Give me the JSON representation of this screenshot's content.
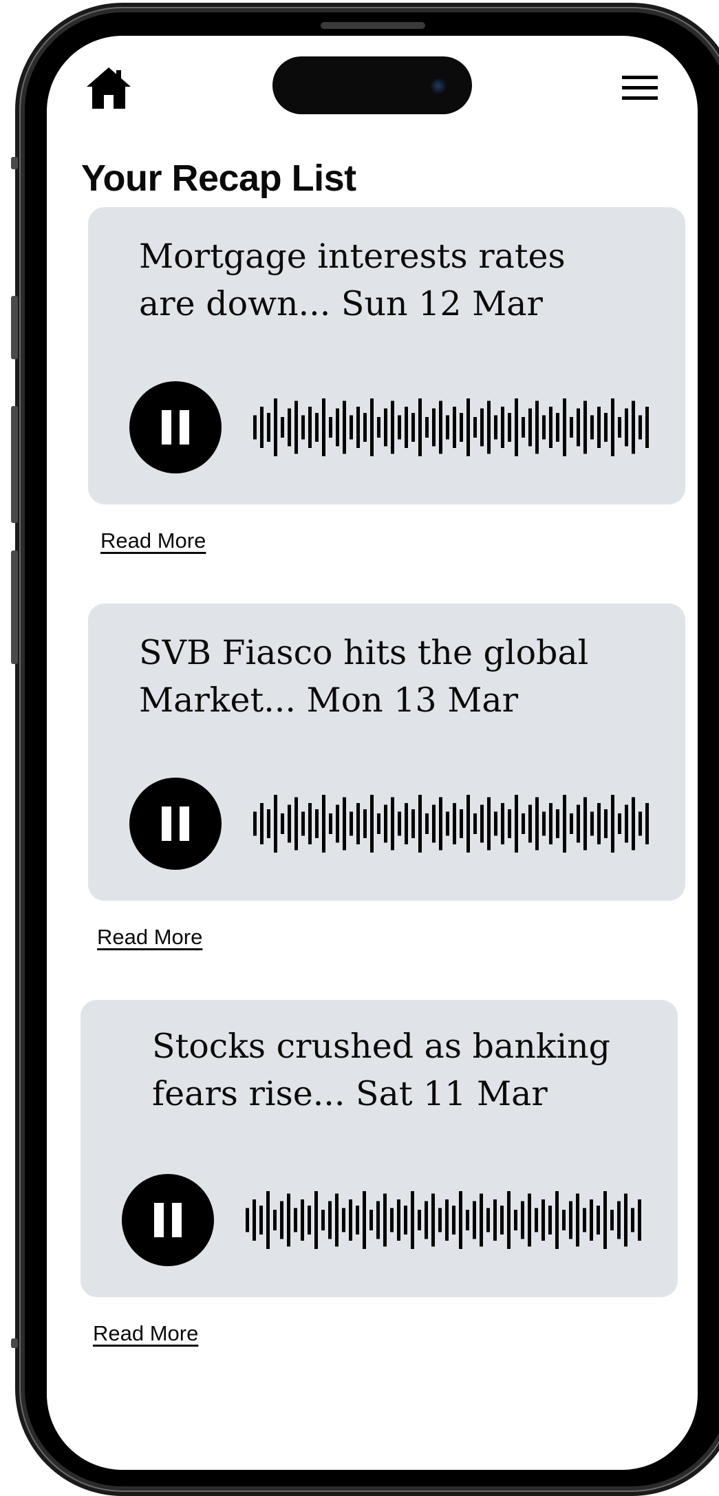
{
  "app": {
    "home_icon": "home-icon",
    "menu_icon": "hamburger-menu-icon"
  },
  "page": {
    "title": "Your Recap List"
  },
  "recaps": [
    {
      "text": "Mortgage interests rates are down... Sun 12 Mar",
      "control_icon": "pause-icon",
      "read_more": "Read More"
    },
    {
      "text": "SVB Fiasco hits the global Market... Mon 13 Mar",
      "control_icon": "pause-icon",
      "read_more": "Read More"
    },
    {
      "text": "Stocks crushed as banking fears rise... Sat 11 Mar",
      "control_icon": "pause-icon",
      "read_more": "Read More"
    }
  ],
  "colors": {
    "card_background": "#e0e4e9",
    "text": "#0a0a0a",
    "control": "#000000"
  }
}
